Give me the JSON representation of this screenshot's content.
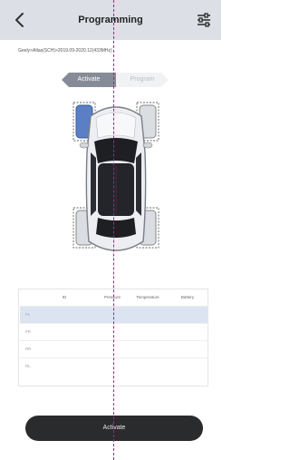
{
  "header": {
    "title": "Programming",
    "back_icon": "chevron-left-icon",
    "settings_icon": "sliders-icon"
  },
  "vehicle": {
    "path": "Geely>Atlas(SCH)>2019.09-2020.12(433MHz)"
  },
  "mode_tabs": {
    "active": "Activate",
    "inactive": "Program"
  },
  "table": {
    "headers": [
      "ID",
      "Pressure",
      "Temperature",
      "Battery"
    ],
    "rows": [
      {
        "id": "FL"
      },
      {
        "id": "FR"
      },
      {
        "id": "RR"
      },
      {
        "id": "RL"
      }
    ],
    "selected_row": 0
  },
  "actions": {
    "activate_label": "Activate"
  },
  "colors": {
    "header_bg": "#dcdfe6",
    "accent_tab": "#868c97",
    "selected_row": "#dde4f1",
    "button_bg": "#2a2b2d",
    "selected_wheel": "#5b7fc4",
    "guide_line": "#c2187a"
  }
}
